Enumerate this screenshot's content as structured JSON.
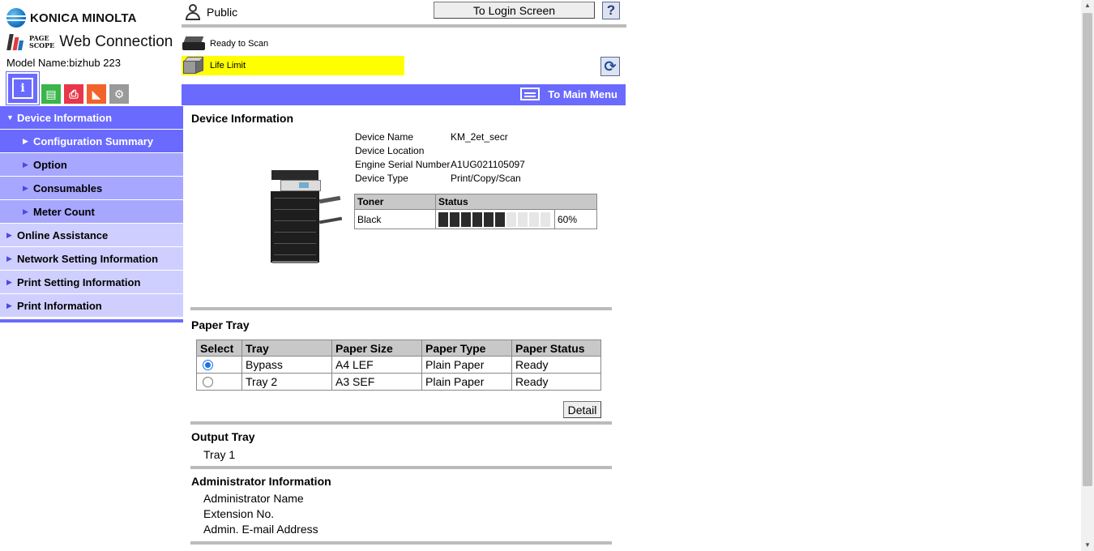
{
  "brand": {
    "company": "KONICA MINOLTA",
    "pagescope_line1": "PAGE",
    "pagescope_line2": "SCOPE",
    "product": "Web Connection",
    "model_name": "Model Name:bizhub 223"
  },
  "header": {
    "user_mode": "Public",
    "login_button": "To Login Screen",
    "help_label": "?",
    "status_scan": "Ready to Scan",
    "status_alert": "Life Limit",
    "alert_color": "#ffff00",
    "main_menu": "To Main Menu",
    "accent_color": "#6a6aff"
  },
  "function_tabs": [
    {
      "icon": "information-icon",
      "label": "i"
    },
    {
      "icon": "job-icon",
      "label": ""
    },
    {
      "icon": "print-icon",
      "label": ""
    },
    {
      "icon": "direct-print-icon",
      "label": ""
    },
    {
      "icon": "settings-box-icon",
      "label": ""
    }
  ],
  "nav": {
    "device_information": "Device Information",
    "configuration_summary": "Configuration Summary",
    "option": "Option",
    "consumables": "Consumables",
    "meter_count": "Meter Count",
    "online_assistance": "Online Assistance",
    "network_setting_information": "Network Setting Information",
    "print_setting_information": "Print Setting Information",
    "print_information": "Print Information"
  },
  "device_info": {
    "title": "Device Information",
    "rows": [
      {
        "label": "Device Name",
        "value": "KM_2et_secr"
      },
      {
        "label": "Device Location",
        "value": ""
      },
      {
        "label": "Engine Serial Number",
        "value": "A1UG021105097"
      },
      {
        "label": "Device Type",
        "value": "Print/Copy/Scan"
      }
    ],
    "toner": {
      "header_toner": "Toner",
      "header_status": "Status",
      "color": "Black",
      "level_percent": 60,
      "level_text": "60%"
    }
  },
  "paper_tray": {
    "title": "Paper Tray",
    "headers": [
      "Select",
      "Tray",
      "Paper Size",
      "Paper Type",
      "Paper Status"
    ],
    "rows": [
      {
        "selected": true,
        "tray": "Bypass",
        "size": "A4 LEF",
        "type": "Plain Paper",
        "status": "Ready"
      },
      {
        "selected": false,
        "tray": "Tray 2",
        "size": "A3 SEF",
        "type": "Plain Paper",
        "status": "Ready"
      }
    ],
    "detail_button": "Detail"
  },
  "output_tray": {
    "title": "Output Tray",
    "value": "Tray 1"
  },
  "admin_info": {
    "title": "Administrator Information",
    "name_label": "Administrator Name",
    "extension_label": "Extension No.",
    "email_label": "Admin. E-mail Address"
  }
}
